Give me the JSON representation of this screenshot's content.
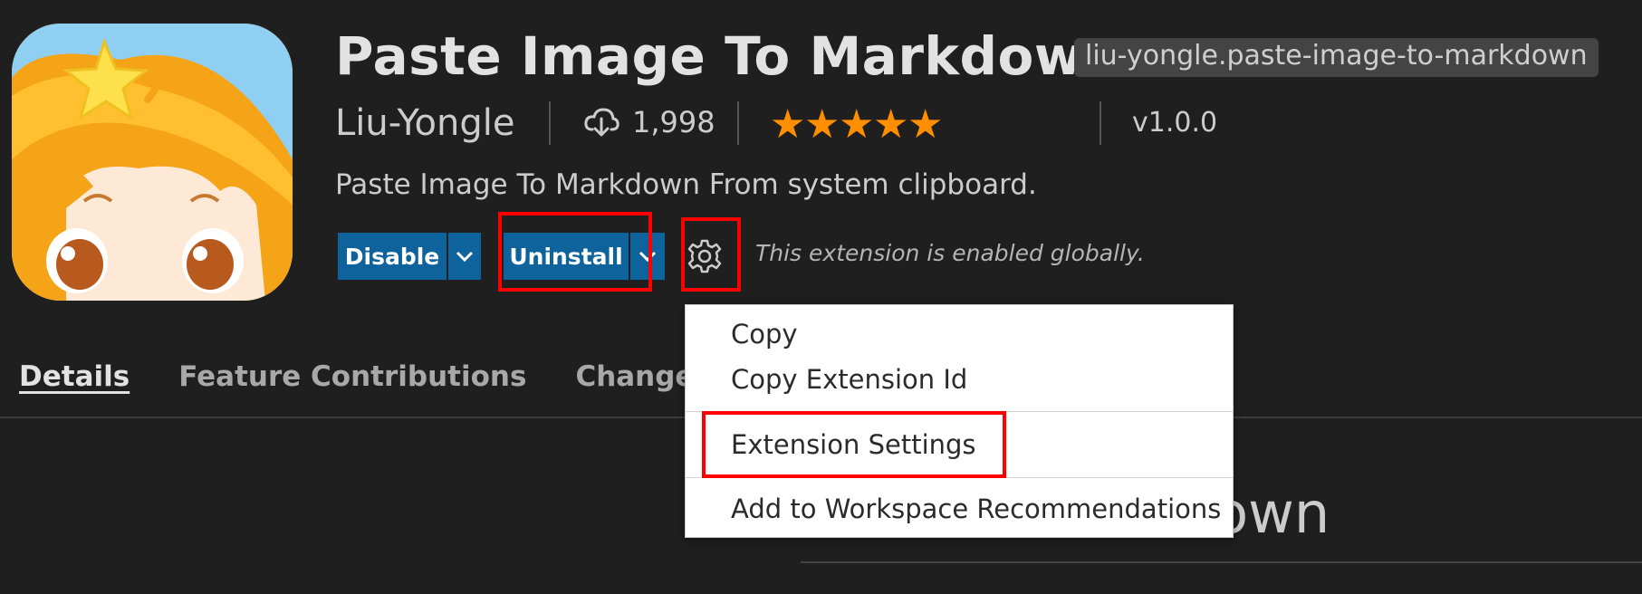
{
  "extension": {
    "title": "Paste Image To Markdown.",
    "identifier": "liu-yongle.paste-image-to-markdown",
    "publisher": "Liu-Yongle",
    "install_count": "1,998",
    "rating_stars": 5,
    "version": "v1.0.0",
    "description": "Paste Image To Markdown From system clipboard."
  },
  "actions": {
    "disable_label": "Disable",
    "uninstall_label": "Uninstall",
    "status_text": "This extension is enabled globally."
  },
  "tabs": [
    {
      "label": "Details",
      "active": true
    },
    {
      "label": "Feature Contributions",
      "active": false
    },
    {
      "label": "Changelog",
      "active": false
    }
  ],
  "background": {
    "heading_fragment": "Markdown"
  },
  "context_menu": {
    "items": [
      {
        "label": "Copy"
      },
      {
        "label": "Copy Extension Id"
      },
      {
        "label": "Extension Settings"
      },
      {
        "label": "Add to Workspace Recommendations"
      }
    ]
  },
  "colors": {
    "background": "#1f1f1f",
    "button": "#0e639c",
    "star": "#ff8e00",
    "highlight": "#ff0000",
    "menu_background": "#ffffff"
  },
  "icons": [
    "cloud-download-icon",
    "star-icon",
    "chevron-down-icon",
    "gear-icon"
  ]
}
